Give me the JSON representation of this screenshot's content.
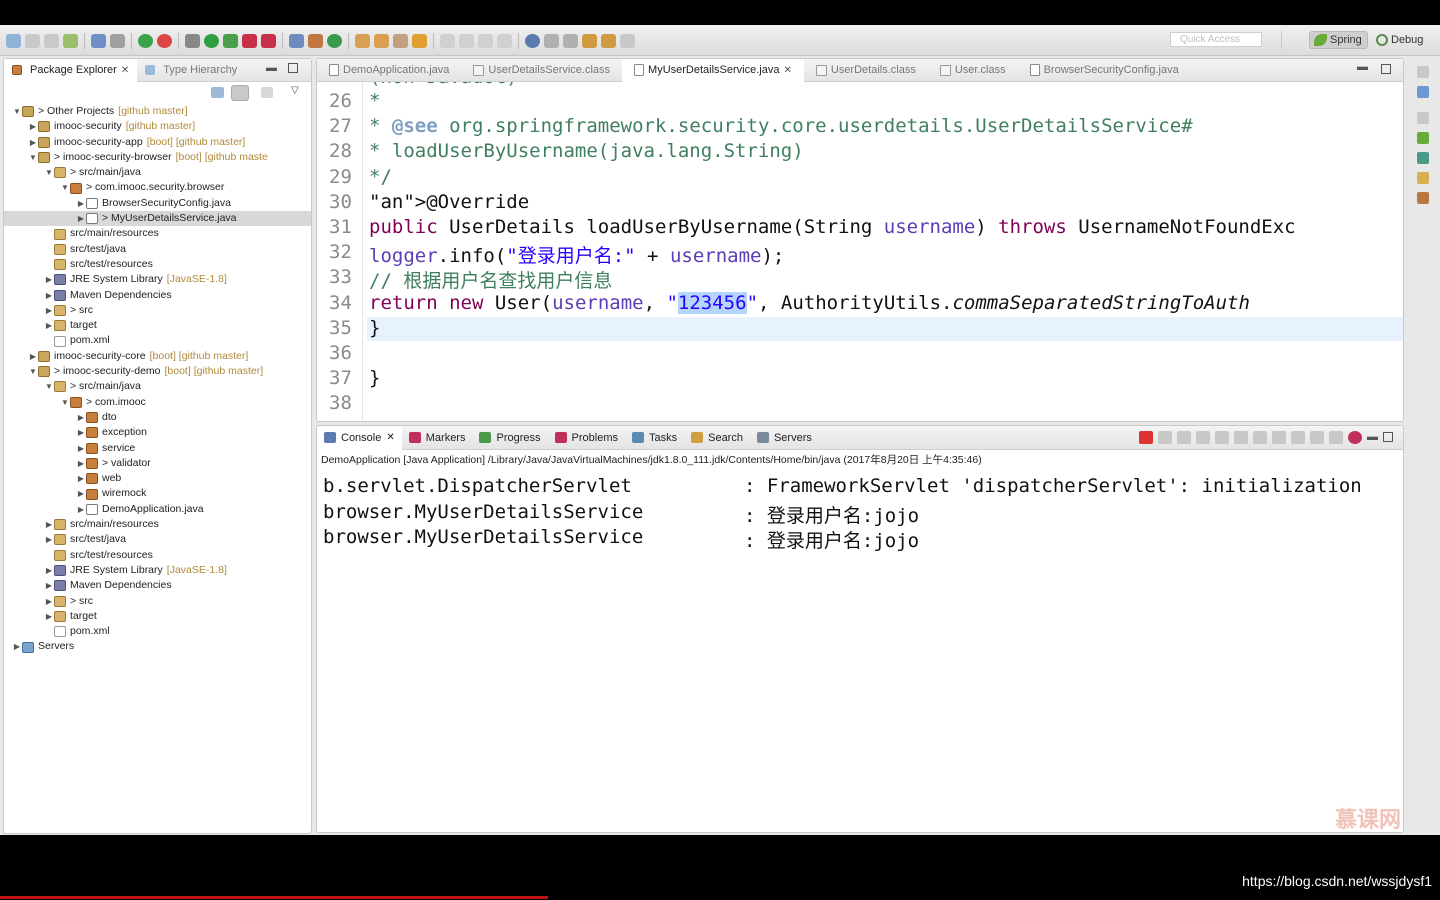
{
  "toolbar": {
    "quick_access_placeholder": "Quick Access",
    "perspectives": [
      {
        "label": "Spring",
        "icon": "spring-leaf-icon",
        "active": true
      },
      {
        "label": "Debug",
        "icon": "debug-icon",
        "active": false
      }
    ]
  },
  "package_explorer": {
    "tabs": [
      {
        "label": "Package Explorer",
        "active": true
      },
      {
        "label": "Type Hierarchy",
        "active": false
      }
    ],
    "tree": [
      {
        "level": 0,
        "arrow": "▼",
        "icon": "working-set",
        "label": "> Other Projects",
        "deco": "[github master]"
      },
      {
        "level": 1,
        "arrow": "▶",
        "icon": "proj",
        "label": "imooc-security",
        "deco": "[github master]"
      },
      {
        "level": 1,
        "arrow": "▶",
        "icon": "proj",
        "label": "imooc-security-app",
        "deco": "[boot] [github master]"
      },
      {
        "level": 1,
        "arrow": "▼",
        "icon": "proj",
        "label": "> imooc-security-browser",
        "deco": "[boot] [github maste"
      },
      {
        "level": 2,
        "arrow": "▼",
        "icon": "src",
        "label": "> src/main/java",
        "deco": ""
      },
      {
        "level": 3,
        "arrow": "▼",
        "icon": "pack",
        "label": "> com.imooc.security.browser",
        "deco": ""
      },
      {
        "level": 4,
        "arrow": "▶",
        "icon": "jv",
        "label": "BrowserSecurityConfig.java",
        "deco": ""
      },
      {
        "level": 4,
        "arrow": "▶",
        "icon": "jv",
        "label": "> MyUserDetailsService.java",
        "deco": "",
        "selected": true
      },
      {
        "level": 2,
        "arrow": "",
        "icon": "src",
        "label": "src/main/resources",
        "deco": ""
      },
      {
        "level": 2,
        "arrow": "",
        "icon": "src",
        "label": "src/test/java",
        "deco": ""
      },
      {
        "level": 2,
        "arrow": "",
        "icon": "src",
        "label": "src/test/resources",
        "deco": ""
      },
      {
        "level": 2,
        "arrow": "▶",
        "icon": "lib",
        "label": "JRE System Library",
        "deco": "[JavaSE-1.8]"
      },
      {
        "level": 2,
        "arrow": "▶",
        "icon": "lib",
        "label": "Maven Dependencies",
        "deco": ""
      },
      {
        "level": 2,
        "arrow": "▶",
        "icon": "folder",
        "label": "> src",
        "deco": ""
      },
      {
        "level": 2,
        "arrow": "▶",
        "icon": "folder",
        "label": "target",
        "deco": ""
      },
      {
        "level": 2,
        "arrow": "",
        "icon": "xml",
        "label": "pom.xml",
        "deco": ""
      },
      {
        "level": 1,
        "arrow": "▶",
        "icon": "proj",
        "label": "imooc-security-core",
        "deco": "[boot] [github master]"
      },
      {
        "level": 1,
        "arrow": "▼",
        "icon": "proj",
        "label": "> imooc-security-demo",
        "deco": "[boot] [github master]"
      },
      {
        "level": 2,
        "arrow": "▼",
        "icon": "src",
        "label": "> src/main/java",
        "deco": ""
      },
      {
        "level": 3,
        "arrow": "▼",
        "icon": "pack",
        "label": "> com.imooc",
        "deco": ""
      },
      {
        "level": 4,
        "arrow": "▶",
        "icon": "pack",
        "label": "dto",
        "deco": ""
      },
      {
        "level": 4,
        "arrow": "▶",
        "icon": "pack",
        "label": "exception",
        "deco": ""
      },
      {
        "level": 4,
        "arrow": "▶",
        "icon": "pack",
        "label": "service",
        "deco": ""
      },
      {
        "level": 4,
        "arrow": "▶",
        "icon": "pack",
        "label": "> validator",
        "deco": ""
      },
      {
        "level": 4,
        "arrow": "▶",
        "icon": "pack",
        "label": "web",
        "deco": ""
      },
      {
        "level": 4,
        "arrow": "▶",
        "icon": "pack",
        "label": "wiremock",
        "deco": ""
      },
      {
        "level": 4,
        "arrow": "▶",
        "icon": "jv",
        "label": "DemoApplication.java",
        "deco": ""
      },
      {
        "level": 2,
        "arrow": "▶",
        "icon": "src",
        "label": "src/main/resources",
        "deco": ""
      },
      {
        "level": 2,
        "arrow": "▶",
        "icon": "src",
        "label": "src/test/java",
        "deco": ""
      },
      {
        "level": 2,
        "arrow": "",
        "icon": "src",
        "label": "src/test/resources",
        "deco": ""
      },
      {
        "level": 2,
        "arrow": "▶",
        "icon": "lib",
        "label": "JRE System Library",
        "deco": "[JavaSE-1.8]"
      },
      {
        "level": 2,
        "arrow": "▶",
        "icon": "lib",
        "label": "Maven Dependencies",
        "deco": ""
      },
      {
        "level": 2,
        "arrow": "▶",
        "icon": "folder",
        "label": "> src",
        "deco": ""
      },
      {
        "level": 2,
        "arrow": "▶",
        "icon": "folder",
        "label": "target",
        "deco": ""
      },
      {
        "level": 2,
        "arrow": "",
        "icon": "xml",
        "label": "pom.xml",
        "deco": ""
      },
      {
        "level": 0,
        "arrow": "▶",
        "icon": "srv",
        "label": "Servers",
        "deco": ""
      }
    ]
  },
  "editor": {
    "tabs": [
      {
        "label": "DemoApplication.java",
        "icon": "java-file-icon",
        "active": false
      },
      {
        "label": "UserDetailsService.class",
        "icon": "class-file-icon",
        "active": false
      },
      {
        "label": "MyUserDetailsService.java",
        "icon": "java-file-icon",
        "active": true
      },
      {
        "label": "UserDetails.class",
        "icon": "class-file-icon",
        "active": false
      },
      {
        "label": "User.class",
        "icon": "class-file-icon",
        "active": false
      },
      {
        "label": "BrowserSecurityConfig.java",
        "icon": "java-file-icon",
        "active": false
      }
    ],
    "lines": [
      {
        "num": "26",
        "code": "   *"
      },
      {
        "num": "27",
        "code": "   * @see org.springframework.security.core.userdetails.UserDetailsService#"
      },
      {
        "num": "28",
        "code": "   * loadUserByUsername(java.lang.String)"
      },
      {
        "num": "29",
        "code": "   */"
      },
      {
        "num": "30",
        "code": "  @Override"
      },
      {
        "num": "31",
        "code": "  public UserDetails loadUserByUsername(String username) throws UsernameNotFoundExc"
      },
      {
        "num": "32",
        "code": "      logger.info(\"登录用户名:\" + username);"
      },
      {
        "num": "33",
        "code": "      // 根据用户名查找用户信息"
      },
      {
        "num": "34",
        "code": "      return new User(username, \"123456\", AuthorityUtils.commaSeparatedStringToAuth"
      },
      {
        "num": "35",
        "code": "  }"
      },
      {
        "num": "36",
        "code": ""
      },
      {
        "num": "37",
        "code": "}"
      },
      {
        "num": "38",
        "code": ""
      }
    ]
  },
  "console": {
    "tabs": [
      {
        "label": "Console",
        "active": true
      },
      {
        "label": "Markers",
        "active": false
      },
      {
        "label": "Progress",
        "active": false
      },
      {
        "label": "Problems",
        "active": false
      },
      {
        "label": "Tasks",
        "active": false
      },
      {
        "label": "Search",
        "active": false
      },
      {
        "label": "Servers",
        "active": false
      }
    ],
    "description": "DemoApplication [Java Application] /Library/Java/JavaVirtualMachines/jdk1.8.0_111.jdk/Contents/Home/bin/java (2017年8月20日 上午4:35:46)",
    "lines": [
      {
        "left": "b.servlet.DispatcherServlet",
        "right": ": FrameworkServlet 'dispatcherServlet': initialization"
      },
      {
        "left": "browser.MyUserDetailsService",
        "right": ": 登录用户名:jojo"
      },
      {
        "left": "browser.MyUserDetailsService",
        "right": ": 登录用户名:jojo"
      }
    ]
  },
  "watermark": "慕课网",
  "footer_url": "https://blog.csdn.net/wssjdysf1"
}
